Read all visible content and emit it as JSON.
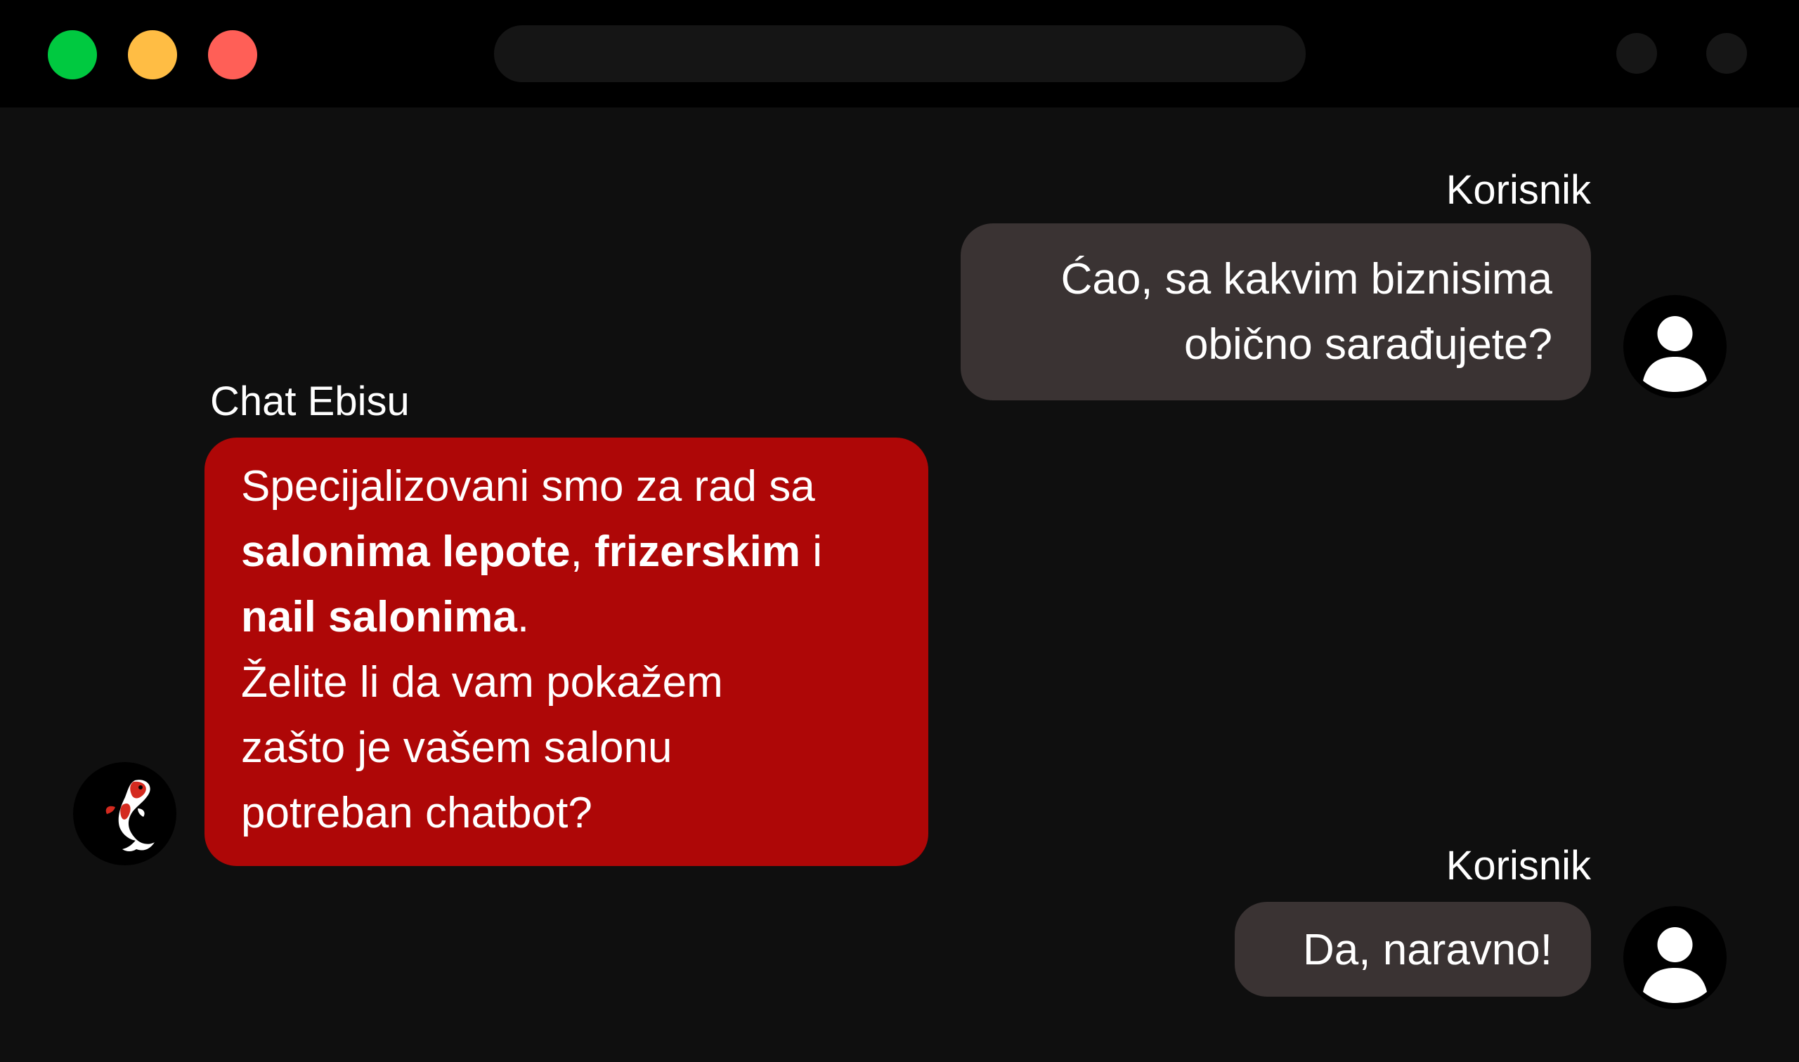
{
  "colors": {
    "titlebar": "#000000",
    "background": "#0f0f0f",
    "traffic_close": "#ff5f57",
    "traffic_minimize": "#ffbd44",
    "traffic_zoom": "#00c940",
    "user_bubble": "#3a3333",
    "bot_bubble": "#ae0707",
    "text": "#ffffff"
  },
  "icons": {
    "user_avatar": "user-silhouette-icon",
    "bot_avatar": "koi-fish-icon"
  },
  "chat": {
    "messages": [
      {
        "sender": "Korisnik",
        "lines": [
          "Ćao, sa kakvim biznisima",
          "obično sarađujete?"
        ]
      },
      {
        "sender": "Chat Ebisu",
        "intro": "Specijalizovani smo za rad sa",
        "bold_1": "salonima lepote",
        "sep_1": ", ",
        "bold_2": "frizerskim",
        "sep_2": " i",
        "bold_3": "nail salonima",
        "sep_3": ".",
        "follow_up": [
          "Želite li da vam pokažem",
          "zašto je vašem salonu",
          "potreban chatbot?"
        ]
      },
      {
        "sender": "Korisnik",
        "lines": [
          "Da, naravno!"
        ]
      }
    ]
  }
}
